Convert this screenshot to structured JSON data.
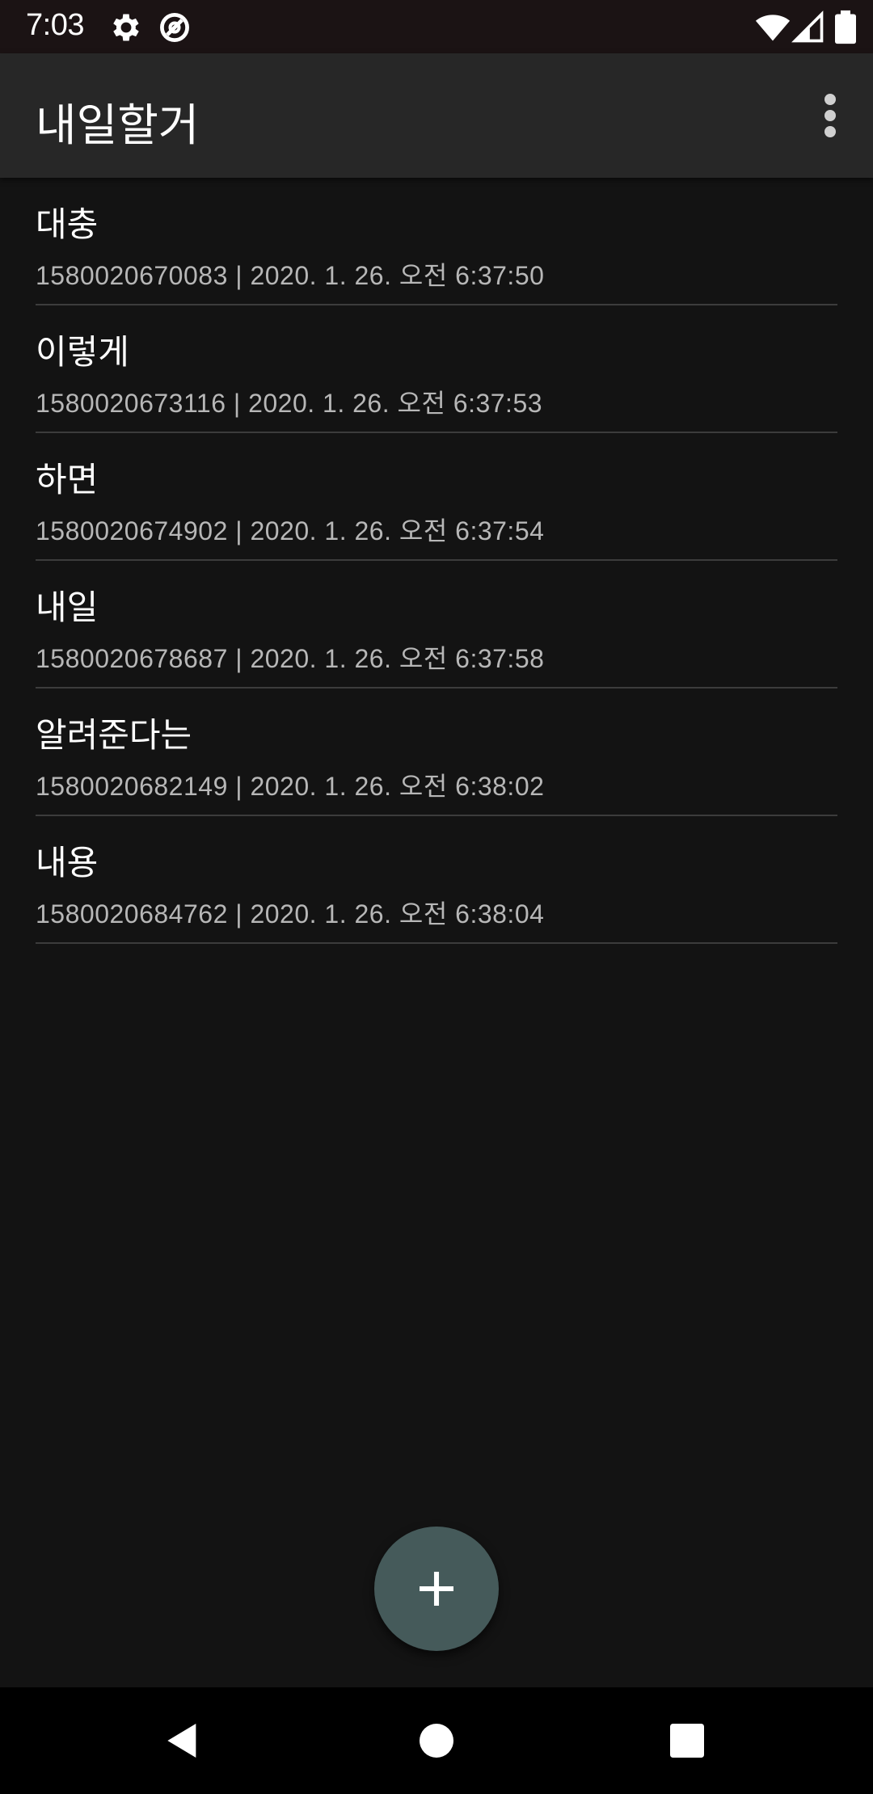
{
  "status_bar": {
    "time": "7:03",
    "icons": [
      "settings-icon",
      "data-saver-icon",
      "wifi-icon",
      "signal-icon",
      "battery-icon"
    ]
  },
  "app_bar": {
    "title": "내일할거",
    "menu_icon": "more-vert-icon"
  },
  "todos": [
    {
      "title": "대충",
      "meta": "1580020670083 | 2020. 1. 26. 오전 6:37:50"
    },
    {
      "title": "이렇게",
      "meta": "1580020673116 | 2020. 1. 26. 오전 6:37:53"
    },
    {
      "title": "하면",
      "meta": "1580020674902 | 2020. 1. 26. 오전 6:37:54"
    },
    {
      "title": "내일",
      "meta": "1580020678687 | 2020. 1. 26. 오전 6:37:58"
    },
    {
      "title": "알려준다는",
      "meta": "1580020682149 | 2020. 1. 26. 오전 6:38:02"
    },
    {
      "title": "내용",
      "meta": "1580020684762 | 2020. 1. 26. 오전 6:38:04"
    }
  ],
  "fab": {
    "icon": "add-icon"
  },
  "nav_bar": {
    "icons": [
      "back-icon",
      "home-icon",
      "recents-icon"
    ]
  },
  "colors": {
    "background": "#131313",
    "app_bar": "#272727",
    "status_bar": "#1b1314",
    "fab": "#455a5a",
    "divider": "#3c3c3c",
    "secondary_text": "#b7b7b7"
  }
}
